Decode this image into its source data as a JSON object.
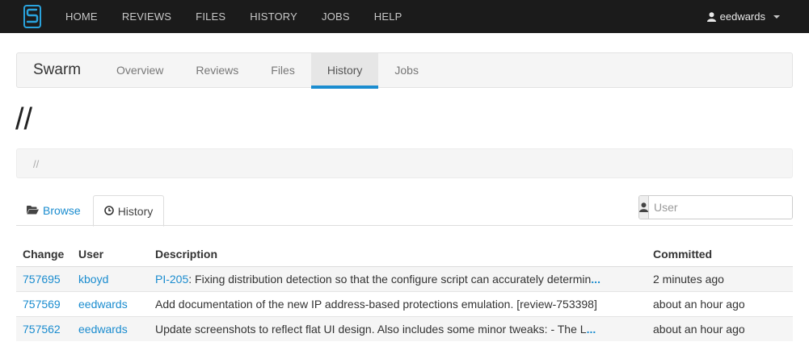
{
  "topnav": {
    "items": [
      "HOME",
      "REVIEWS",
      "FILES",
      "HISTORY",
      "JOBS",
      "HELP"
    ],
    "user": "eedwards"
  },
  "project": {
    "brand": "Swarm",
    "tabs": [
      "Overview",
      "Reviews",
      "Files",
      "History",
      "Jobs"
    ],
    "active_tab": "History"
  },
  "page": {
    "title": "//",
    "breadcrumb": "//"
  },
  "subtabs": {
    "browse": "Browse",
    "history": "History"
  },
  "filter": {
    "placeholder": "User"
  },
  "table": {
    "headers": [
      "Change",
      "User",
      "Description",
      "Committed"
    ],
    "rows": [
      {
        "change": "757695",
        "user": "kboyd",
        "desc_link": "PI-205",
        "desc_text": ": Fixing distribution detection so that the configure script can accurately determin",
        "truncated": "...",
        "committed": "2 minutes ago"
      },
      {
        "change": "757569",
        "user": "eedwards",
        "desc_link": "",
        "desc_text": "Add documentation of the new IP address-based protections emulation. [review-753398]",
        "truncated": "",
        "committed": "about an hour ago"
      },
      {
        "change": "757562",
        "user": "eedwards",
        "desc_link": "",
        "desc_text": "Update screenshots to reflect flat UI design. Also includes some minor tweaks: - The L",
        "truncated": "...",
        "committed": "about an hour ago"
      }
    ]
  },
  "colors": {
    "accent": "#1a8ccf",
    "navbar": "#1b1b1b"
  }
}
